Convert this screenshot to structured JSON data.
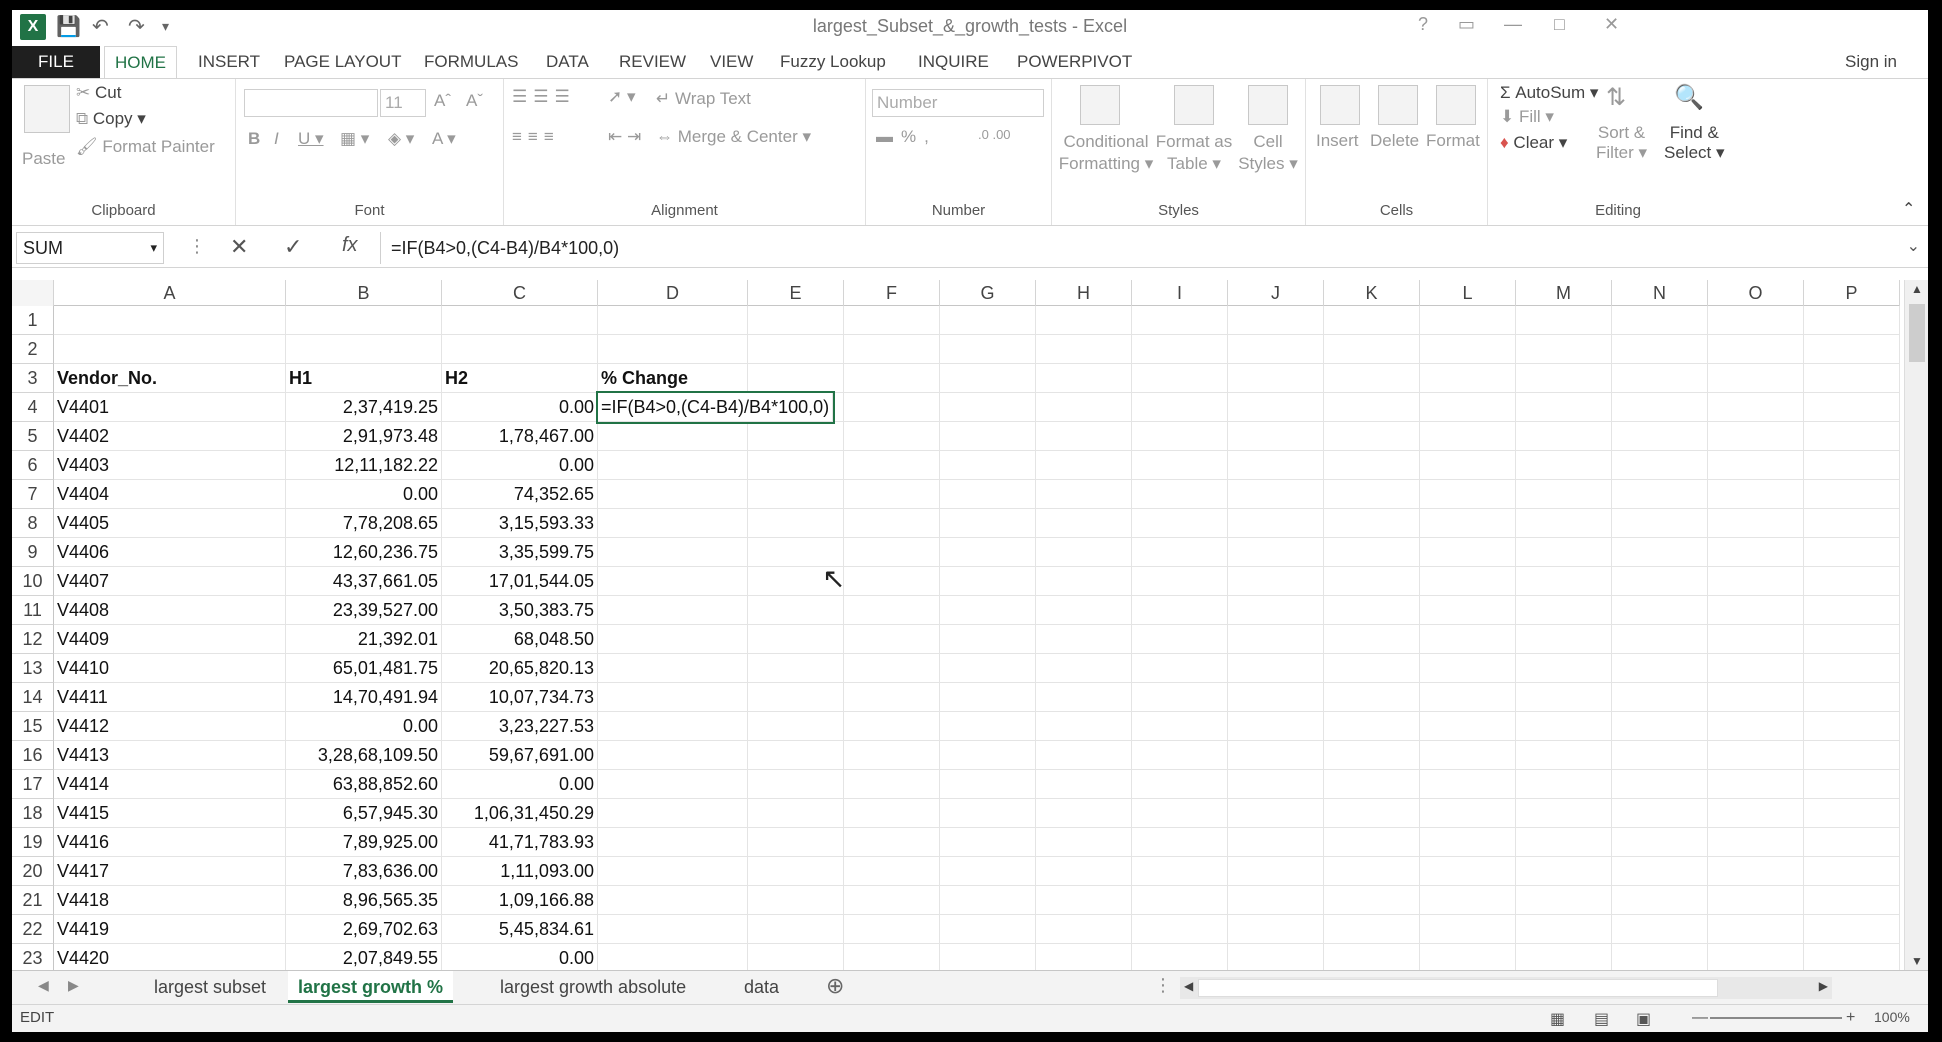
{
  "window": {
    "title": "largest_Subset_&_growth_tests - Excel",
    "sign_in": "Sign in"
  },
  "ribbon_tabs": [
    "FILE",
    "HOME",
    "INSERT",
    "PAGE LAYOUT",
    "FORMULAS",
    "DATA",
    "REVIEW",
    "VIEW",
    "Fuzzy Lookup",
    "INQUIRE",
    "POWERPIVOT"
  ],
  "ribbon": {
    "clipboard": {
      "paste": "Paste",
      "cut": "Cut",
      "copy": "Copy",
      "format_painter": "Format Painter",
      "label": "Clipboard"
    },
    "font": {
      "size": "11",
      "label": "Font"
    },
    "alignment": {
      "wrap": "Wrap Text",
      "merge": "Merge & Center",
      "label": "Alignment"
    },
    "number": {
      "format": "Number",
      "label": "Number"
    },
    "styles": {
      "conditional_1": "Conditional",
      "conditional_2": "Formatting",
      "format_table_1": "Format as",
      "format_table_2": "Table",
      "cell_styles_1": "Cell",
      "cell_styles_2": "Styles",
      "label": "Styles"
    },
    "cells": {
      "insert": "Insert",
      "delete": "Delete",
      "format": "Format",
      "label": "Cells"
    },
    "editing": {
      "autosum": "AutoSum",
      "fill": "Fill",
      "clear": "Clear",
      "sort_1": "Sort &",
      "sort_2": "Filter",
      "find_1": "Find &",
      "find_2": "Select",
      "label": "Editing"
    }
  },
  "formula_bar": {
    "name_box": "SUM",
    "formula": "=IF(B4>0,(C4-B4)/B4*100,0)"
  },
  "columns": [
    "A",
    "B",
    "C",
    "D",
    "E",
    "F",
    "G",
    "H",
    "I",
    "J",
    "K",
    "L",
    "M",
    "N",
    "O",
    "P"
  ],
  "row_numbers": [
    "1",
    "2",
    "3",
    "4",
    "5",
    "6",
    "7",
    "8",
    "9",
    "10",
    "11",
    "12",
    "13",
    "14",
    "15",
    "16",
    "17",
    "18",
    "19",
    "20",
    "21",
    "22",
    "23"
  ],
  "headers": {
    "a": "Vendor_No.",
    "b": "H1",
    "c": "H2",
    "d": "% Change"
  },
  "editing_cell": "=IF(B4>0,(C4-B4)/B4*100,0)",
  "rows": [
    [
      "V4401",
      "2,37,419.25",
      "0.00"
    ],
    [
      "V4402",
      "2,91,973.48",
      "1,78,467.00"
    ],
    [
      "V4403",
      "12,11,182.22",
      "0.00"
    ],
    [
      "V4404",
      "0.00",
      "74,352.65"
    ],
    [
      "V4405",
      "7,78,208.65",
      "3,15,593.33"
    ],
    [
      "V4406",
      "12,60,236.75",
      "3,35,599.75"
    ],
    [
      "V4407",
      "43,37,661.05",
      "17,01,544.05"
    ],
    [
      "V4408",
      "23,39,527.00",
      "3,50,383.75"
    ],
    [
      "V4409",
      "21,392.01",
      "68,048.50"
    ],
    [
      "V4410",
      "65,01,481.75",
      "20,65,820.13"
    ],
    [
      "V4411",
      "14,70,491.94",
      "10,07,734.73"
    ],
    [
      "V4412",
      "0.00",
      "3,23,227.53"
    ],
    [
      "V4413",
      "3,28,68,109.50",
      "59,67,691.00"
    ],
    [
      "V4414",
      "63,88,852.60",
      "0.00"
    ],
    [
      "V4415",
      "6,57,945.30",
      "1,06,31,450.29"
    ],
    [
      "V4416",
      "7,89,925.00",
      "41,71,783.93"
    ],
    [
      "V4417",
      "7,83,636.00",
      "1,11,093.00"
    ],
    [
      "V4418",
      "8,96,565.35",
      "1,09,166.88"
    ],
    [
      "V4419",
      "2,69,702.63",
      "5,45,834.61"
    ],
    [
      "V4420",
      "2,07,849.55",
      "0.00"
    ]
  ],
  "sheet_tabs": [
    "largest subset",
    "largest growth %",
    "largest growth absolute",
    "data"
  ],
  "status": {
    "mode": "EDIT",
    "zoom": "100%"
  }
}
